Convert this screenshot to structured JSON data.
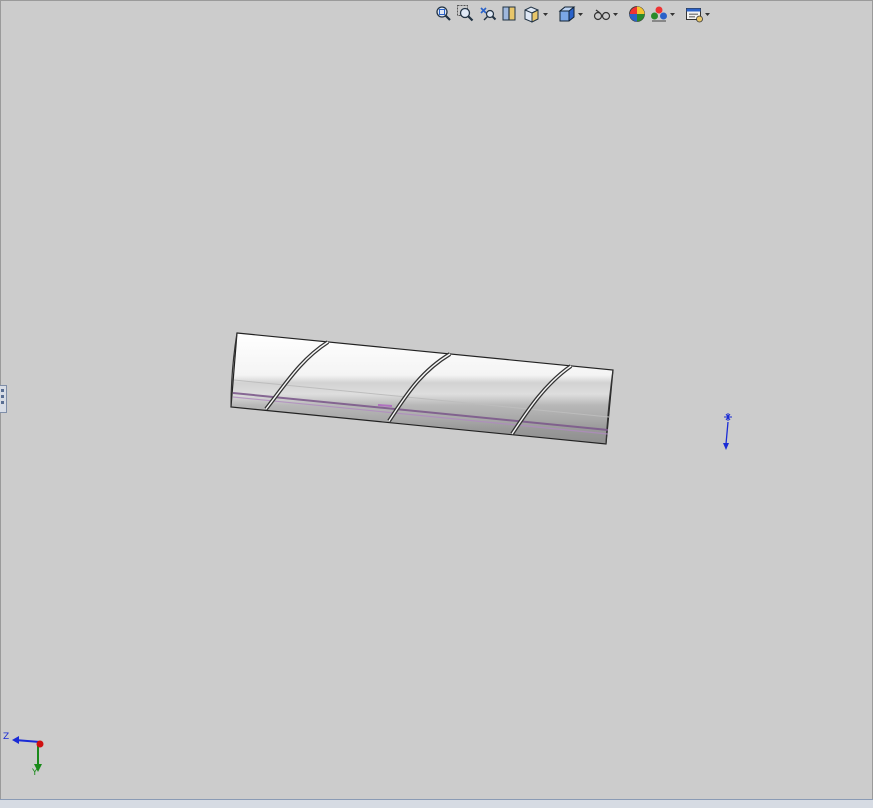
{
  "app": {
    "title": ""
  },
  "heads_up_toolbar": {
    "items": [
      {
        "name": "zoom-to-fit",
        "icon": "zoom-to-fit-icon",
        "has_dropdown": false
      },
      {
        "name": "zoom-to-area",
        "icon": "zoom-to-area-icon",
        "has_dropdown": false
      },
      {
        "name": "previous-view",
        "icon": "previous-view-icon",
        "has_dropdown": false
      },
      {
        "name": "section-view",
        "icon": "section-view-icon",
        "has_dropdown": false
      },
      {
        "name": "view-orientation",
        "icon": "view-orientation-icon",
        "has_dropdown": true
      },
      {
        "name": "display-style",
        "icon": "display-style-icon",
        "has_dropdown": true
      },
      {
        "name": "hide-show-items",
        "icon": "hide-show-icon",
        "has_dropdown": true
      },
      {
        "name": "edit-appearance",
        "icon": "edit-appearance-icon",
        "has_dropdown": false
      },
      {
        "name": "apply-scene",
        "icon": "apply-scene-icon",
        "has_dropdown": true
      },
      {
        "name": "view-settings",
        "icon": "view-settings-icon",
        "has_dropdown": true
      }
    ]
  },
  "triad": {
    "z_label": "Z",
    "y_label": "Y"
  },
  "colors": {
    "background": "#cccccc",
    "model_light": "#ffffff",
    "model_shade": "#9a9a9a",
    "edge": "#1a1a1a",
    "accent_purple": "#a060b8",
    "axis_blue": "#1a2bd6",
    "axis_green": "#1a8a1a",
    "axis_red": "#d01010"
  }
}
